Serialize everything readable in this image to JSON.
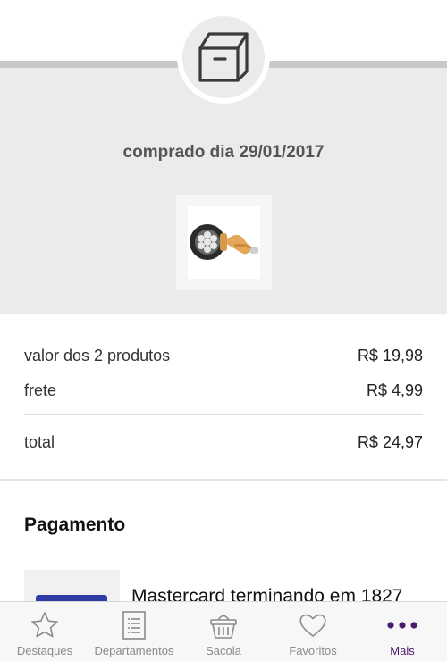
{
  "order": {
    "date_text": "comprado dia 29/01/2017",
    "box_icon": "box-icon",
    "product_thumbnail": "flashlight-product-image"
  },
  "values": {
    "products_label": "valor dos 2 produtos",
    "products_value": "R$ 19,98",
    "shipping_label": "frete",
    "shipping_value": "R$ 4,99",
    "total_label": "total",
    "total_value": "R$ 24,97"
  },
  "payment": {
    "title": "Pagamento",
    "card_text": "Mastercard terminando em 1827",
    "card_icon": "credit-card-icon"
  },
  "bottom_nav": {
    "items": [
      {
        "label": "Destaques",
        "icon": "star-icon",
        "active": false
      },
      {
        "label": "Departamentos",
        "icon": "list-icon",
        "active": false
      },
      {
        "label": "Sacola",
        "icon": "basket-icon",
        "active": false
      },
      {
        "label": "Favoritos",
        "icon": "heart-icon",
        "active": false
      },
      {
        "label": "Mais",
        "icon": "more-dots-icon",
        "active": true
      }
    ]
  },
  "colors": {
    "accent": "#4a1a6e",
    "background_gray": "#ebebeb",
    "nav_inactive": "#8a8a8a"
  }
}
